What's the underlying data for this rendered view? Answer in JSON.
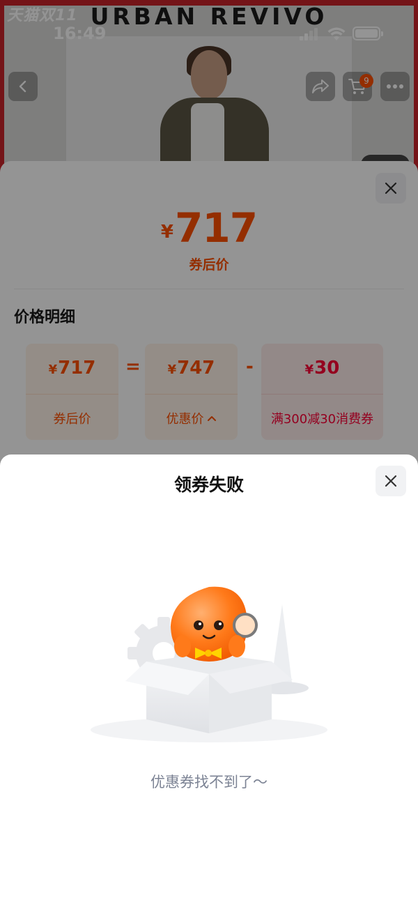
{
  "status_bar": {
    "time": "16:49",
    "icons": [
      "signal-icon",
      "wifi-icon",
      "battery-icon"
    ]
  },
  "banner": {
    "tmall_tag": "天猫双11",
    "brand": "URBAN REVIVO"
  },
  "nav": {
    "icons": [
      "back-icon",
      "share-icon",
      "cart-icon",
      "more-icon"
    ],
    "cart_badge": "9"
  },
  "price_sheet": {
    "currency": "¥",
    "final_price": "717",
    "final_label": "券后价",
    "section_title": "价格明细",
    "calc": {
      "final": {
        "currency": "¥",
        "value": "717",
        "label": "券后价"
      },
      "equals": "=",
      "discount_price": {
        "currency": "¥",
        "value": "747",
        "label": "优惠价"
      },
      "minus": "-",
      "coupon": {
        "currency": "¥",
        "value": "30",
        "label": "满300减30消费券"
      }
    }
  },
  "coupon_fail": {
    "title": "领券失败",
    "message": "优惠券找不到了～"
  },
  "colors": {
    "accent_orange": "#ff5000",
    "accent_red": "#ff0036",
    "banner_red": "#c9242a"
  }
}
